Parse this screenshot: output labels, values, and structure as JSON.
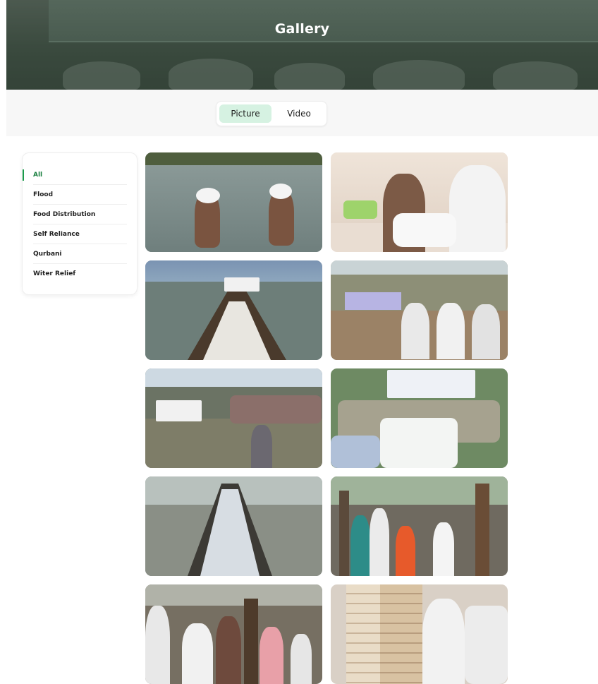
{
  "header": {
    "title": "Gallery"
  },
  "media_tabs": [
    {
      "label": "Picture",
      "active": true
    },
    {
      "label": "Video",
      "active": false
    }
  ],
  "categories": [
    {
      "label": "All",
      "active": true
    },
    {
      "label": "Flood",
      "active": false
    },
    {
      "label": "Food Distribution",
      "active": false
    },
    {
      "label": "Self Reliance",
      "active": false
    },
    {
      "label": "Qurbani",
      "active": false
    },
    {
      "label": "Witer Relief",
      "active": false
    }
  ],
  "colors": {
    "accent": "#1a9b4b",
    "active_tab_bg": "#d6f2e2"
  }
}
